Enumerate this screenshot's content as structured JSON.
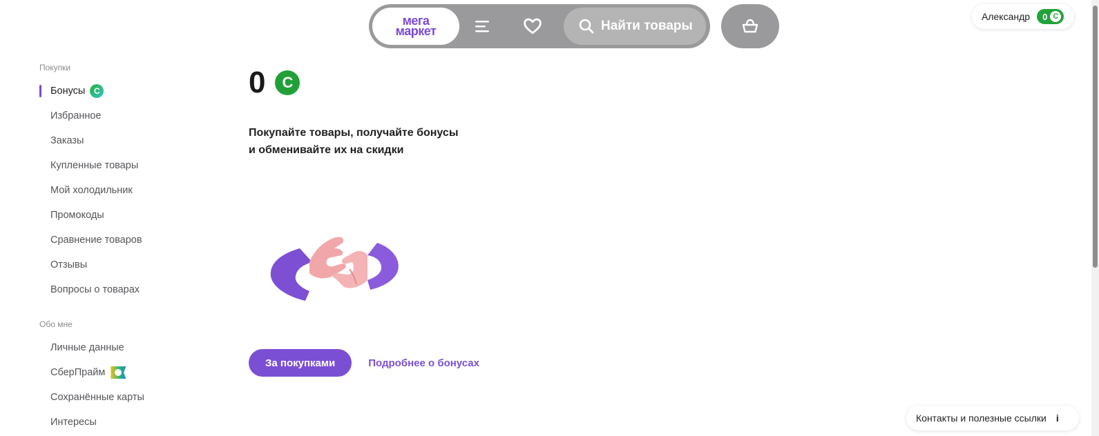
{
  "header": {
    "logo_line1": "мега",
    "logo_line2": "маркет",
    "search_placeholder": "Найти товары"
  },
  "user": {
    "name": "Александр",
    "bonus_count": "0",
    "bonus_symbol": "С"
  },
  "sidebar": {
    "sections": [
      {
        "title": "Покупки",
        "items": [
          {
            "label": "Бонусы",
            "active": true
          },
          {
            "label": "Избранное"
          },
          {
            "label": "Заказы"
          },
          {
            "label": "Купленные товары"
          },
          {
            "label": "Мой холодильник"
          },
          {
            "label": "Промокоды"
          },
          {
            "label": "Сравнение товаров"
          },
          {
            "label": "Отзывы"
          },
          {
            "label": "Вопросы о товарах"
          }
        ]
      },
      {
        "title": "Обо мне",
        "items": [
          {
            "label": "Личные данные"
          },
          {
            "label": "СберПрайм"
          },
          {
            "label": "Сохранённые карты"
          },
          {
            "label": "Интересы"
          }
        ]
      }
    ]
  },
  "main": {
    "balance": "0",
    "balance_symbol": "С",
    "promo_line1": "Покупайте товары, получайте бонусы",
    "promo_line2": "и обменивайте их на скидки",
    "primary_button": "За покупками",
    "more_link": "Подробнее о бонусах"
  },
  "footer": {
    "contacts_label": "Контакты и полезные ссылки",
    "info_symbol": "i"
  },
  "colors": {
    "accent": "#7b4fd4",
    "bonus_green": "#21a038",
    "header_grey": "#9a9a9c"
  }
}
